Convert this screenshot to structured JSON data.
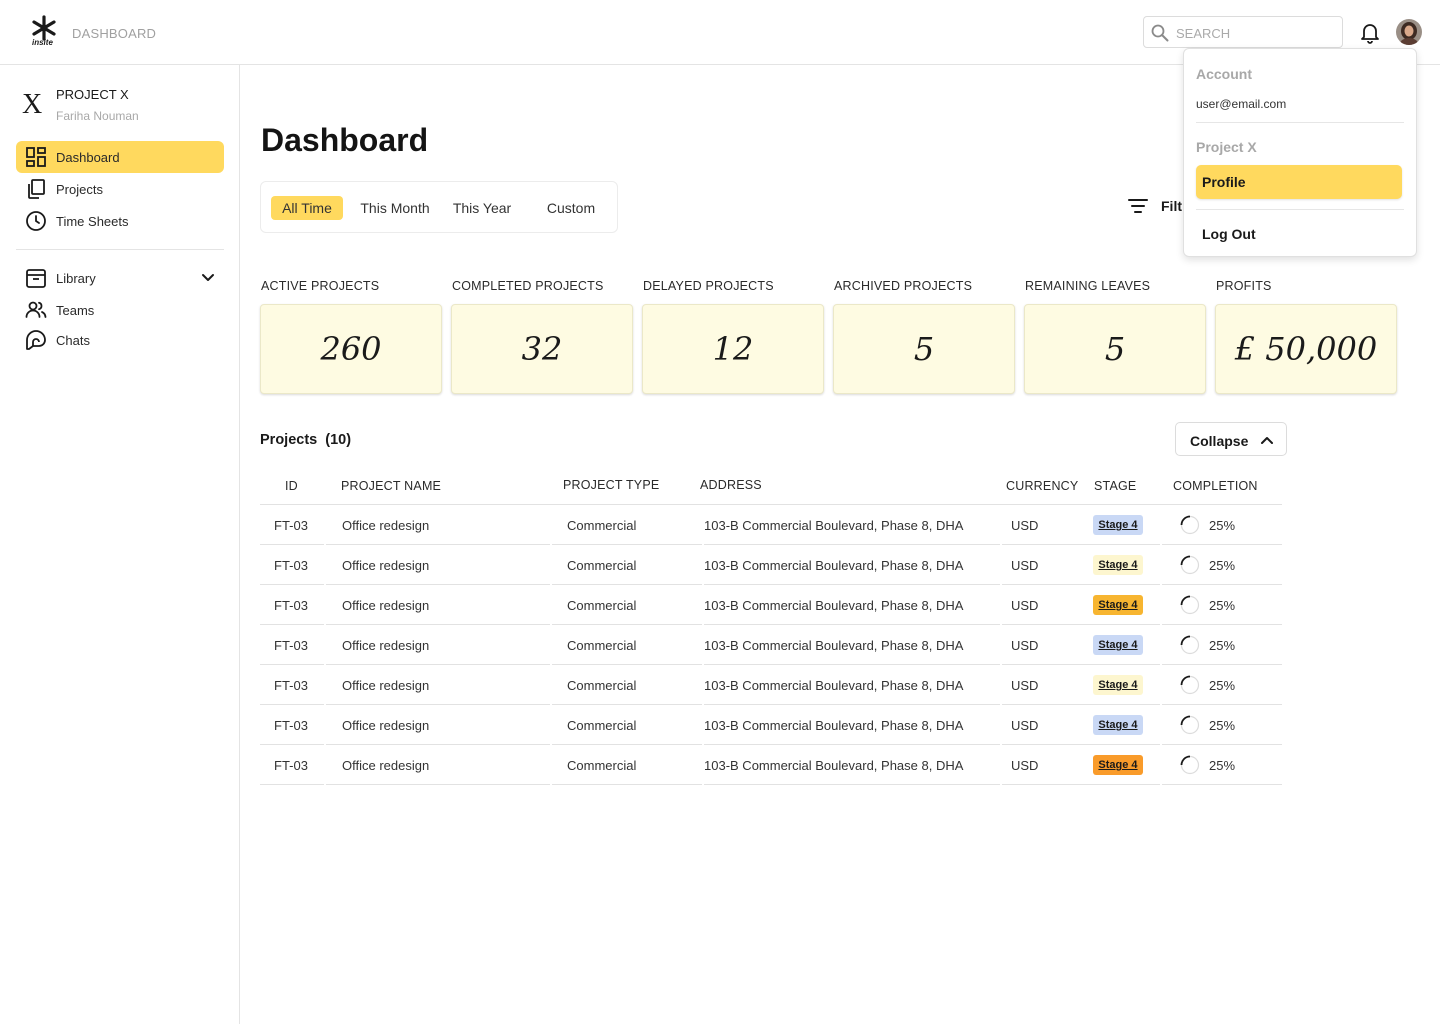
{
  "header": {
    "logo_text": "insite",
    "breadcrumb": "DASHBOARD",
    "search_placeholder": "SEARCH"
  },
  "sidebar": {
    "project_mark": "X",
    "project_name": "PROJECT X",
    "project_owner": "Fariha Nouman",
    "items": [
      {
        "label": "Dashboard",
        "icon": "dashboard-icon",
        "active": true
      },
      {
        "label": "Projects",
        "icon": "projects-icon"
      },
      {
        "label": "Time Sheets",
        "icon": "clock-icon"
      },
      {
        "label": "Library",
        "icon": "archive-icon"
      },
      {
        "label": "Teams",
        "icon": "users-icon"
      },
      {
        "label": "Chats",
        "icon": "chat-icon"
      }
    ]
  },
  "main": {
    "title": "Dashboard",
    "ranges": [
      "All Time",
      "This Month",
      "This Year",
      "Custom"
    ],
    "active_range": "All Time",
    "filter_label": "Filt",
    "stats": [
      {
        "label": "ACTIVE PROJECTS",
        "value": "260"
      },
      {
        "label": "COMPLETED PROJECTS",
        "value": "32"
      },
      {
        "label": "DELAYED PROJECTS",
        "value": "12"
      },
      {
        "label": "ARCHIVED PROJECTS",
        "value": "5"
      },
      {
        "label": "REMAINING LEAVES",
        "value": "5"
      },
      {
        "label": "PROFITS",
        "value": "£ 50,000"
      }
    ],
    "projects_title": "Projects  (10)",
    "collapse_label": "Collapse"
  },
  "table": {
    "columns": [
      "ID",
      "PROJECT NAME",
      "PROJECT TYPE",
      "ADDRESS",
      "CURRENCY",
      "STAGE",
      "COMPLETION"
    ],
    "rows": [
      {
        "id": "FT-03",
        "name": "Office redesign",
        "type": "Commercial",
        "address": "103-B Commercial Boulevard, Phase 8, DHA",
        "currency": "USD",
        "stage": "Stage 4",
        "stage_color": "#c9d8f5",
        "completion": "25%"
      },
      {
        "id": "FT-03",
        "name": "Office redesign",
        "type": "Commercial",
        "address": "103-B Commercial Boulevard, Phase 8, DHA",
        "currency": "USD",
        "stage": "Stage 4",
        "stage_color": "#fdf6cf",
        "completion": "25%"
      },
      {
        "id": "FT-03",
        "name": "Office redesign",
        "type": "Commercial",
        "address": "103-B Commercial Boulevard, Phase 8, DHA",
        "currency": "USD",
        "stage": "Stage 4",
        "stage_color": "#f7b530",
        "completion": "25%"
      },
      {
        "id": "FT-03",
        "name": "Office redesign",
        "type": "Commercial",
        "address": "103-B Commercial Boulevard, Phase 8, DHA",
        "currency": "USD",
        "stage": "Stage 4",
        "stage_color": "#c9d8f5",
        "completion": "25%"
      },
      {
        "id": "FT-03",
        "name": "Office redesign",
        "type": "Commercial",
        "address": "103-B Commercial Boulevard, Phase 8, DHA",
        "currency": "USD",
        "stage": "Stage 4",
        "stage_color": "#fdf6cf",
        "completion": "25%"
      },
      {
        "id": "FT-03",
        "name": "Office redesign",
        "type": "Commercial",
        "address": "103-B Commercial Boulevard, Phase 8, DHA",
        "currency": "USD",
        "stage": "Stage 4",
        "stage_color": "#c9d8f5",
        "completion": "25%"
      },
      {
        "id": "FT-03",
        "name": "Office redesign",
        "type": "Commercial",
        "address": "103-B Commercial Boulevard, Phase 8, DHA",
        "currency": "USD",
        "stage": "Stage 4",
        "stage_color": "#f99b2a",
        "completion": "25%"
      }
    ]
  },
  "account_menu": {
    "account_heading": "Account",
    "email": "user@email.com",
    "project_heading": "Project X",
    "profile_label": "Profile",
    "logout_label": "Log Out"
  },
  "colors": {
    "accent": "#ffd95e",
    "card_bg": "#fefbe2"
  }
}
